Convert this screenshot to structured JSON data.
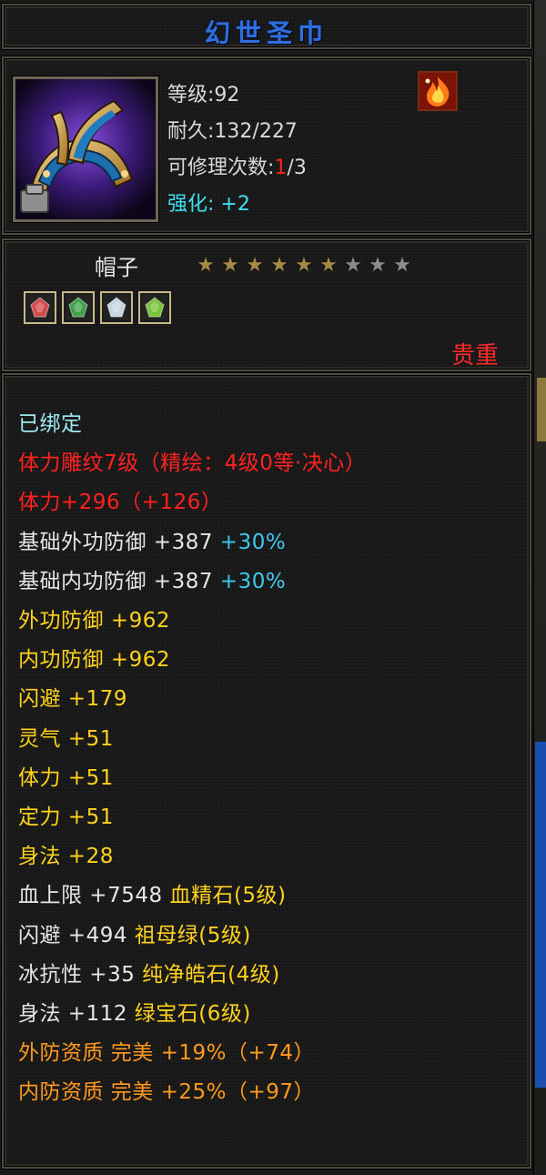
{
  "item": {
    "name": "幻世圣巾",
    "level_label": "等级:92",
    "durability_label": "耐久:132/227",
    "repair_prefix": "可修理次数:",
    "repair_used": "1",
    "repair_suffix": "/3",
    "enhance_label": "强化:",
    "enhance_value": "+2",
    "type": "帽子",
    "stars_total": 9,
    "stars_filled": 6,
    "rarity": "贵重"
  },
  "gems": [
    {
      "icon": "red-gem-icon",
      "color": "#d44b4b"
    },
    {
      "icon": "green-jade-icon",
      "color": "#3fa34a"
    },
    {
      "icon": "white-gem-icon",
      "color": "#c9d6e0"
    },
    {
      "icon": "green-gem-icon",
      "color": "#7ac43a"
    }
  ],
  "stats": [
    {
      "parts": [
        {
          "text": "已绑定",
          "color": "cyan"
        }
      ]
    },
    {
      "parts": [
        {
          "text": "体力雕纹7级（精绘：4级0等·决心）",
          "color": "red"
        }
      ]
    },
    {
      "parts": [
        {
          "text": "体力+296（+126）",
          "color": "red"
        }
      ]
    },
    {
      "parts": [
        {
          "text": "基础外功防御 +387 ",
          "color": "white"
        },
        {
          "text": "+30%",
          "color": "blue"
        }
      ]
    },
    {
      "parts": [
        {
          "text": "基础内功防御 +387 ",
          "color": "white"
        },
        {
          "text": "+30%",
          "color": "blue"
        }
      ]
    },
    {
      "parts": [
        {
          "text": "外功防御 +962",
          "color": "gold"
        }
      ]
    },
    {
      "parts": [
        {
          "text": "内功防御 +962",
          "color": "gold"
        }
      ]
    },
    {
      "parts": [
        {
          "text": "闪避 +179",
          "color": "gold"
        }
      ]
    },
    {
      "parts": [
        {
          "text": "灵气 +51",
          "color": "gold"
        }
      ]
    },
    {
      "parts": [
        {
          "text": "体力 +51",
          "color": "gold"
        }
      ]
    },
    {
      "parts": [
        {
          "text": "定力 +51",
          "color": "gold"
        }
      ]
    },
    {
      "parts": [
        {
          "text": "身法 +28",
          "color": "gold"
        }
      ]
    },
    {
      "parts": [
        {
          "text": "血上限 +7548 ",
          "color": "white"
        },
        {
          "text": "血精石(5级)",
          "color": "gold"
        }
      ]
    },
    {
      "parts": [
        {
          "text": "闪避 +494 ",
          "color": "white"
        },
        {
          "text": "祖母绿(5级)",
          "color": "gold"
        }
      ]
    },
    {
      "parts": [
        {
          "text": "冰抗性 +35 ",
          "color": "white"
        },
        {
          "text": "纯净皓石(4级)",
          "color": "gold"
        }
      ]
    },
    {
      "parts": [
        {
          "text": "身法 +112 ",
          "color": "white"
        },
        {
          "text": "绿宝石(6级)",
          "color": "gold"
        }
      ]
    },
    {
      "parts": [
        {
          "text": "外防资质  完美 +19%（+74）",
          "color": "orange"
        }
      ]
    },
    {
      "parts": [
        {
          "text": "内防资质  完美 +25%（+97）",
          "color": "orange"
        }
      ]
    }
  ]
}
